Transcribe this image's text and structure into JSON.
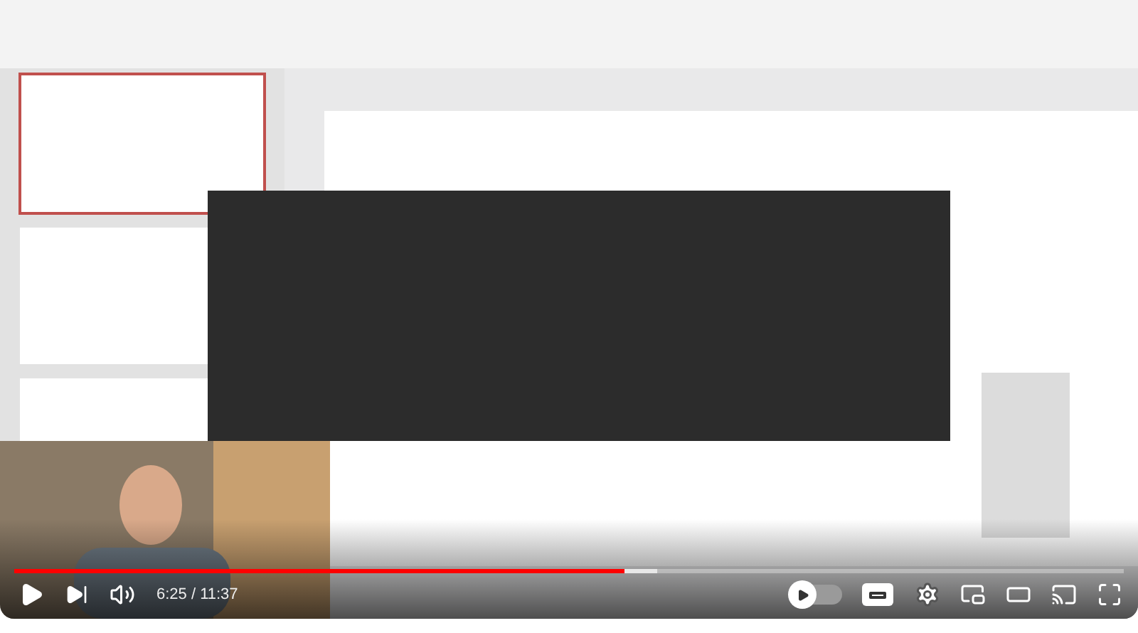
{
  "player": {
    "played": {
      "level": 0.55
    },
    "buffered": {
      "level": 0.58
    },
    "time": "6:25 / 11:37",
    "autoplay": {
      "on": false
    }
  }
}
